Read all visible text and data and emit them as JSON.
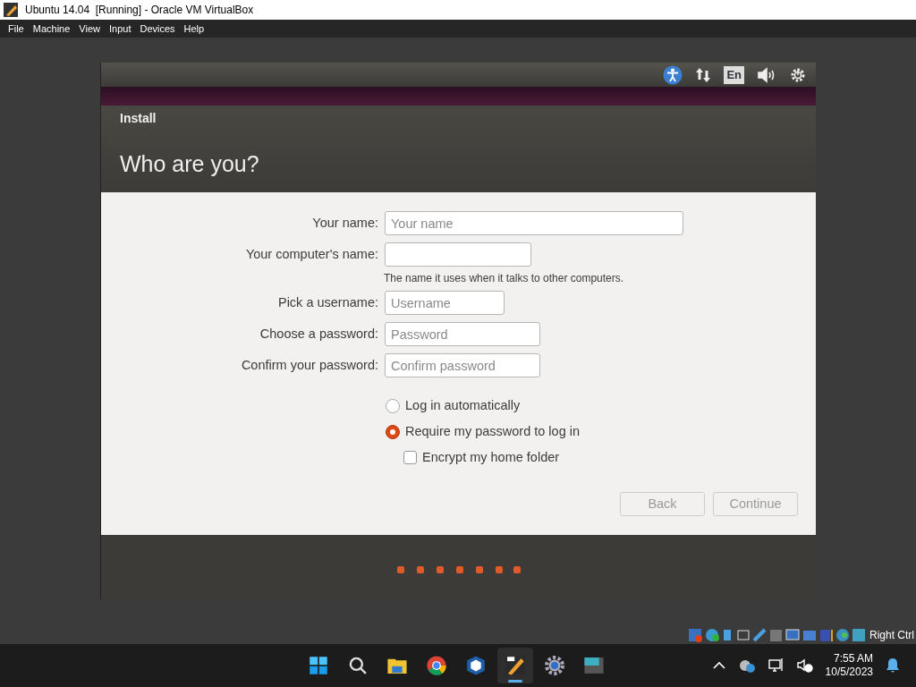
{
  "window": {
    "title": "Ubuntu 14.04  [Running] - Oracle VM VirtualBox"
  },
  "menu": [
    "File",
    "Machine",
    "View",
    "Input",
    "Devices",
    "Help"
  ],
  "panel": {
    "keyboard_layout": "En"
  },
  "dialog": {
    "header": "Install",
    "title": "Who are you?",
    "fields": [
      {
        "label": "Your name:",
        "placeholder": "Your name"
      },
      {
        "label": "Your computer's name:",
        "hint": "The name it uses when it talks to other computers."
      },
      {
        "label": "Pick a username:",
        "placeholder": "Username"
      },
      {
        "label": "Choose a password:",
        "placeholder": "Password"
      },
      {
        "label": "Confirm your password:",
        "placeholder": "Confirm password"
      }
    ],
    "login_options": [
      {
        "label": "Log in automatically",
        "selected": false
      },
      {
        "label": "Require my password to log in",
        "selected": true
      }
    ],
    "encrypt": {
      "label": "Encrypt my home folder",
      "checked": false
    },
    "buttons": [
      {
        "label": "Back",
        "disabled": true
      },
      {
        "label": "Continue",
        "disabled": true
      }
    ]
  },
  "status_bar": {
    "host_key": "Right Ctrl"
  },
  "taskbar": {
    "apps": [
      {
        "kind": "start",
        "selected": false
      },
      {
        "kind": "search",
        "selected": false
      },
      {
        "kind": "files",
        "selected": false
      },
      {
        "kind": "browser",
        "selected": false
      },
      {
        "kind": "cube",
        "selected": false
      },
      {
        "kind": "vm",
        "selected": true
      },
      {
        "kind": "settings",
        "selected": false
      },
      {
        "kind": "terminal",
        "selected": false
      }
    ],
    "time": "7:55 AM",
    "date": "10/5/2023"
  }
}
